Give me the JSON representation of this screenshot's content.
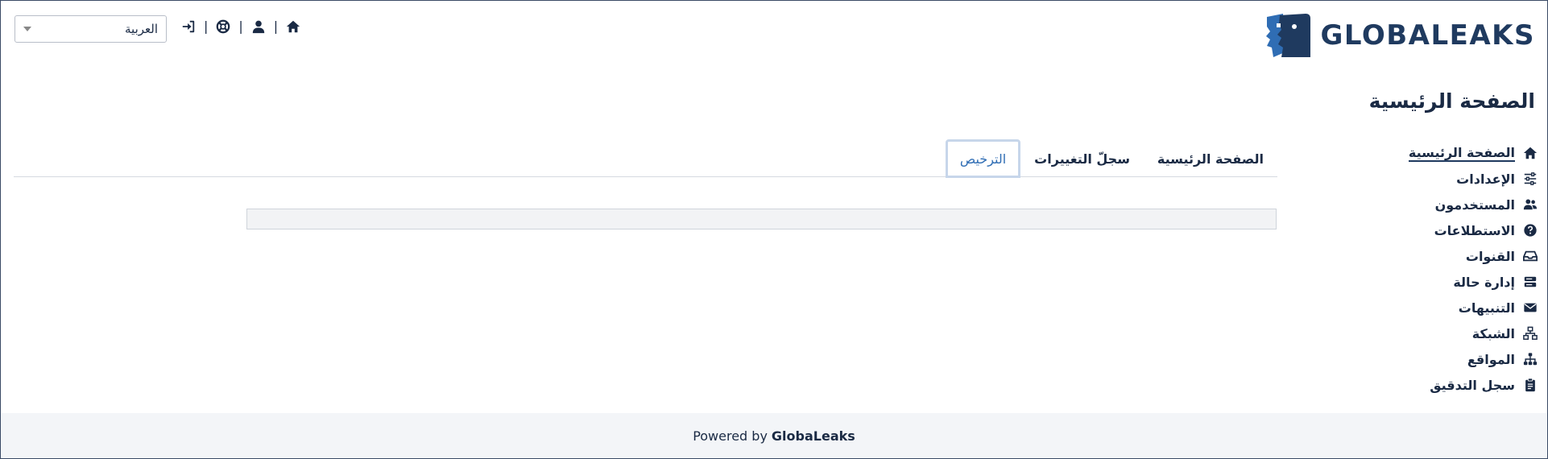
{
  "brand": {
    "name": "GLOBALEAKS"
  },
  "language": {
    "selected": "العربية"
  },
  "top_icons": [
    "home-icon",
    "user-icon",
    "lifebuoy-icon",
    "login-icon"
  ],
  "page": {
    "title": "الصفحة الرئيسية"
  },
  "sidebar": {
    "items": [
      {
        "label": "الصفحة الرئيسية",
        "icon": "home-icon",
        "active": true
      },
      {
        "label": "الإعدادات",
        "icon": "sliders-icon"
      },
      {
        "label": "المستخدمون",
        "icon": "users-icon"
      },
      {
        "label": "الاستطلاعات",
        "icon": "question-circle-icon"
      },
      {
        "label": "القنوات",
        "icon": "inbox-icon"
      },
      {
        "label": "إدارة حالة",
        "icon": "server-icon"
      },
      {
        "label": "التنبيهات",
        "icon": "envelope-icon"
      },
      {
        "label": "الشبكة",
        "icon": "network-icon"
      },
      {
        "label": "المواقع",
        "icon": "sitemap-icon"
      },
      {
        "label": "سجل التدقيق",
        "icon": "clipboard-icon"
      }
    ]
  },
  "tabs": [
    {
      "label": "الصفحة الرئيسية"
    },
    {
      "label": "سجلّ التغييرات"
    },
    {
      "label": "الترخيص",
      "active": true
    }
  ],
  "footer": {
    "prefix": "Powered by",
    "brand": "GlobaLeaks"
  },
  "colors": {
    "primary": "#1f3a5f",
    "accent": "#2f6db4",
    "footer_bg": "#f3f5f8"
  }
}
